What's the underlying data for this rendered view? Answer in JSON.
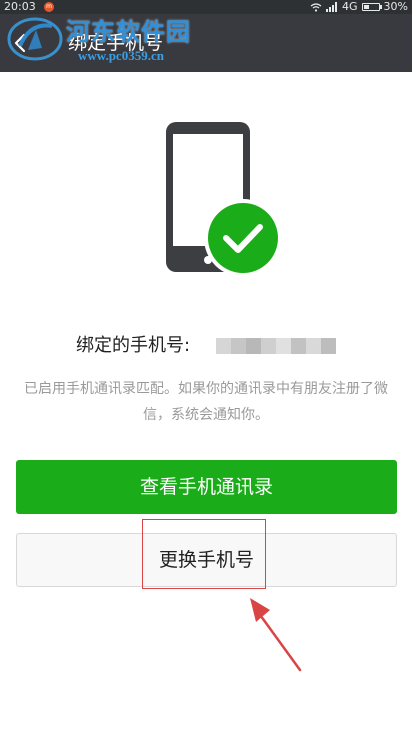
{
  "status_bar": {
    "time": "20:03",
    "network": "4G",
    "battery": "30%",
    "notification_badge": "m"
  },
  "nav": {
    "title": "绑定手机号"
  },
  "watermark": {
    "site_name": "河东软件园",
    "url": "www.pc0359.cn"
  },
  "content": {
    "bound_label": "绑定的手机号:",
    "description": "已启用手机通讯录匹配。如果你的通讯录中有朋友注册了微信，系统会通知你。"
  },
  "buttons": {
    "view_contacts": "查看手机通讯录",
    "change_phone": "更换手机号"
  },
  "colors": {
    "nav_bg": "#393a3f",
    "primary_green": "#1aad19",
    "annotation_red": "#d94545"
  }
}
